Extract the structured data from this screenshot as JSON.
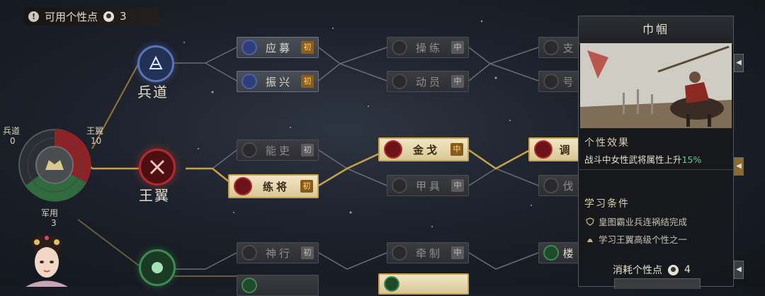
{
  "header": {
    "label": "可用个性点",
    "points": "3",
    "info_icon": "!"
  },
  "categories": {
    "bingdao": {
      "label": "兵道"
    },
    "wangyi": {
      "label": "王翼"
    },
    "junyong": {
      "label": "军用"
    }
  },
  "radar": {
    "bingdao_label": "兵道",
    "bingdao_value": "0",
    "wangyi_label": "王翼",
    "wangyi_value": "10",
    "junyong_label": "军用",
    "junyong_value": "3"
  },
  "skills": {
    "yingmu": {
      "name": "应募",
      "tag": "初"
    },
    "zhenxing": {
      "name": "振兴",
      "tag": "初"
    },
    "caolian": {
      "name": "操练",
      "tag": "中"
    },
    "dongyuan": {
      "name": "动员",
      "tag": "中"
    },
    "neng": {
      "name": "能吏",
      "tag": "初"
    },
    "lianjiang": {
      "name": "练将",
      "tag": "初"
    },
    "jinge": {
      "name": "金戈",
      "tag": "中"
    },
    "jiaju": {
      "name": "甲具",
      "tag": "中"
    },
    "shenxing": {
      "name": "神行",
      "tag": "初"
    },
    "qianzhi": {
      "name": "牵制",
      "tag": "中"
    },
    "zhi": {
      "name": "支"
    },
    "hao": {
      "name": "号"
    },
    "tiao": {
      "name": "调"
    },
    "fa": {
      "name": "伐"
    },
    "lou": {
      "name": "楼"
    }
  },
  "panel": {
    "title": "巾帼",
    "effect_heading": "个性效果",
    "effect_text": "战斗中女性武将属性上升",
    "effect_value": "15%",
    "req_heading": "学习条件",
    "req_1": "皇图霸业兵连祸结完成",
    "req_2": "学习王翼高级个性之一",
    "cost_label": "消耗个性点",
    "cost_value": "4"
  },
  "colors": {
    "gold_line": "#c9a04a",
    "red_node": "#b22b2d",
    "green_node": "#3f8a52",
    "blue_node": "#4c61a6",
    "effect_pct": "#5fd08a"
  }
}
